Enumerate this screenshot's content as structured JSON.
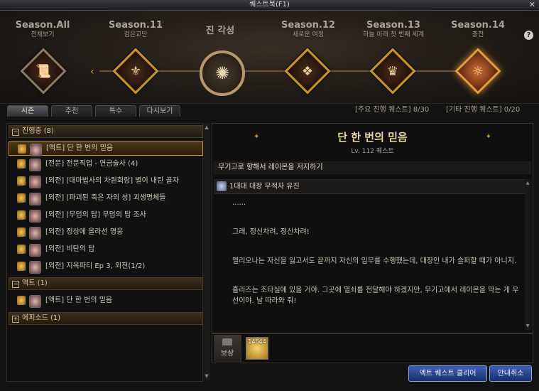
{
  "window": {
    "title": "퀘스트북(F1)",
    "close": "✕"
  },
  "seasons": [
    {
      "name": "Season.All",
      "sub": "전체보기"
    },
    {
      "name": "Season.11",
      "sub": "검은교단"
    },
    {
      "name": "진 각성",
      "sub": ""
    },
    {
      "name": "Season.12",
      "sub": "새로운 여정"
    },
    {
      "name": "Season.13",
      "sub": "하늘 아래 첫 번째 세계"
    },
    {
      "name": "Season.14",
      "sub": "충전"
    }
  ],
  "help": "?",
  "tabs": [
    "시즌",
    "추천",
    "특수",
    "다시보기"
  ],
  "counts": {
    "main": "[주요 진행 퀘스트] 8/30",
    "other": "[기타 진행 퀘스트] 0/20"
  },
  "groups": {
    "progress": "진행중 (8)",
    "act": "액트 (1)",
    "episode": "에피소드 (1)"
  },
  "quests": [
    "[액트] 단 한 번의 믿음",
    "[전문] 전문직업 - 연금술사 (4)",
    "[외전] [대마법사의 차원회랑] 별이 내린 골자",
    "[외전] [파괴된 죽은 자의 성] 괴생명체들",
    "[외전] [무덤의 탑] 무덤의 탑 조사",
    "[외전] 정상에 올라선 영웅",
    "[외전] 비탄의 탑",
    "[외전] 지옥파티 Ep 3, 외전(1/2)"
  ],
  "act_quests": [
    "[액트] 단 한 번의 믿음"
  ],
  "detail": {
    "title": "단 한 번의 믿음",
    "level": "Lv. 112 퀘스트",
    "objective": "무기고로 향해서 레이몬을 저지하기",
    "npc": "1대대 대장 무적자 유진",
    "lines": [
      "......",
      "그래, 정신차려, 정신차려!",
      "멜리오나는 자신을 잃고서도 끝까지 자신의 임무를 수행했는데, 대장인 내가 슬퍼할 때가 아니지.",
      "흘리즈는 조타실에 있을 거야. 그곳에 열쇠를 전달해야 하겠지만, 무기고에서 레이몬을 막는 게 우선이야. 날 따라와 줘!"
    ]
  },
  "rewards": {
    "label": "보상",
    "gold_count": "14544"
  },
  "buttons": {
    "clear": "액트 퀘스트 클리어",
    "cancel": "안내취소"
  }
}
